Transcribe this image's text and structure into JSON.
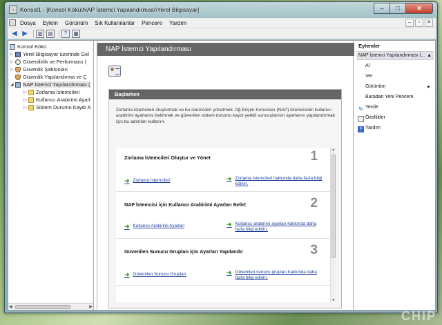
{
  "window": {
    "title": "Konsol1 - [Konsol Kökü\\NAP İstemci Yapılandırması\\Yerel Bilgisayar]",
    "minimize": "–",
    "maximize": "□",
    "close": "✕"
  },
  "menu": {
    "items": [
      "Dosya",
      "Eylem",
      "Görünüm",
      "Sık Kullanılanlar",
      "Pencere",
      "Yardım"
    ],
    "right_buttons": [
      "–",
      "▫",
      "✕"
    ]
  },
  "toolbar": {
    "back": "◀",
    "forward": "▶",
    "help": "?"
  },
  "tree": {
    "items": [
      {
        "label": "Konsol Kökü",
        "icon": "console-icon"
      },
      {
        "label": "Yerel Bilgisayar üzerinde Gel",
        "icon": "computer-icon"
      },
      {
        "label": "Güvenilirlik ve Performans (",
        "icon": "gauge-icon"
      },
      {
        "label": "Güvenlik Şablonları",
        "icon": "shield-icon"
      },
      {
        "label": "Güvenlik Yapılandırma ve Ç",
        "icon": "shield-icon"
      },
      {
        "label": "NAP İstemci Yapılandırması (",
        "icon": "nap-icon"
      },
      {
        "label": "Zorlama İstemcileri",
        "icon": "folder-icon"
      },
      {
        "label": "Kullanıcı Arabirimi Ayarl",
        "icon": "folder-icon"
      },
      {
        "label": "Sistem Durumu Kaydı A",
        "icon": "folder-icon"
      }
    ]
  },
  "main": {
    "header": "NAP İstemci Yapılandırması",
    "getting_started": {
      "title": "Başlarken",
      "description": "Zorlama istemcileri oluşturmak ve bu istemcileri yönetmek. Ağ Erişim Koruması (NAP) istemcisinin kullanıcı arabirimi ayarlarını belirtmek ve güvenilen sistem durumu kaydı yetkili sunucularının ayarlarını yapılandırmak için bu adımları kullanın."
    },
    "steps": [
      {
        "title": "Zorlama İstemcileri Oluştur ve Yönet",
        "number": "1",
        "link1": "Zorlama İstemcileri",
        "link2": "Zorlama istemcileri hakkında daha fazla bilgi edinin."
      },
      {
        "title": "NAP İstemcisi için Kullanıcı Arabirimi Ayarları Belirt",
        "number": "2",
        "link1": "Kullanıcı Arabirimi Ayarları",
        "link2": "Kullanıcı arabirimi ayarları hakkında daha fazla bilgi edinin."
      },
      {
        "title": "Güvenilen Sunucu Grupları için Ayarları Yapılandır",
        "number": "3",
        "link1": "Güvenilen Sunucu Grupları",
        "link2": "Güvenilen sunucu grupları hakkında daha fazla bilgi edinin."
      }
    ]
  },
  "actions": {
    "title": "Eylemler",
    "section": "NAP İstemci Yapılandırması (...",
    "items": [
      "Al",
      "Ver",
      "Görünüm",
      "Buradan Yeni Pencere",
      "Yenile",
      "Özellikler",
      "Yardım"
    ]
  },
  "watermark": "CHIP"
}
